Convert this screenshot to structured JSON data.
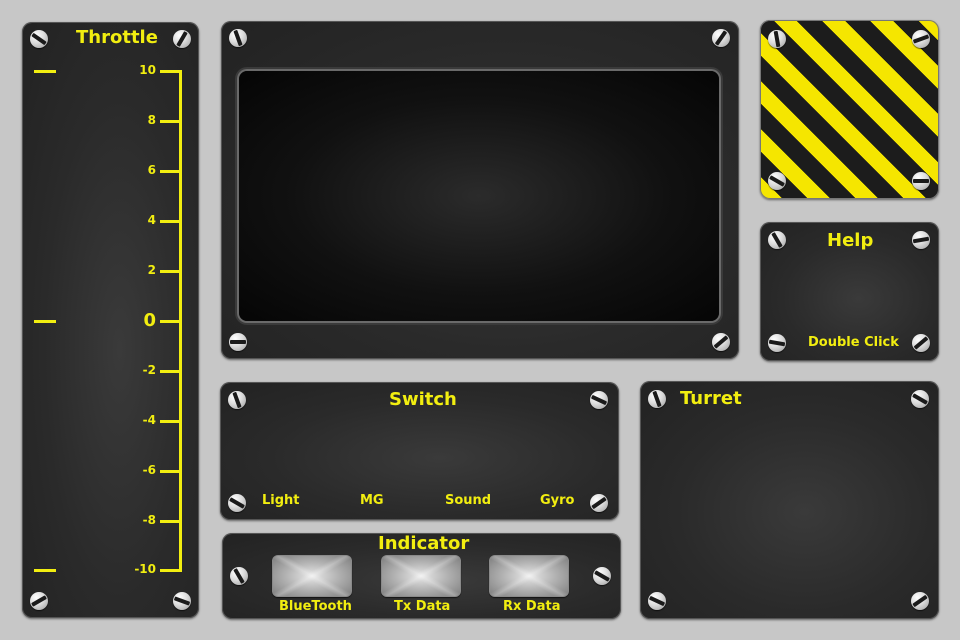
{
  "colors": {
    "accent_yellow": "#f2ee10",
    "background": "#c7c7c7",
    "panel": "#2a2a2a"
  },
  "throttle": {
    "title": "Throttle",
    "ticks": [
      "10",
      "8",
      "6",
      "4",
      "2",
      "0",
      "-2",
      "-4",
      "-6",
      "-8",
      "-10"
    ]
  },
  "display": {
    "label": "",
    "icon": "monitor-screen"
  },
  "hazard": {
    "icon": "hazard-stripes"
  },
  "help": {
    "title": "Help",
    "hint": "Double Click"
  },
  "switch": {
    "title": "Switch",
    "items": [
      "Light",
      "MG",
      "Sound",
      "Gyro"
    ]
  },
  "indicator": {
    "title": "Indicator",
    "items": [
      "BlueTooth",
      "Tx Data",
      "Rx Data"
    ]
  },
  "turret": {
    "title": "Turret"
  }
}
